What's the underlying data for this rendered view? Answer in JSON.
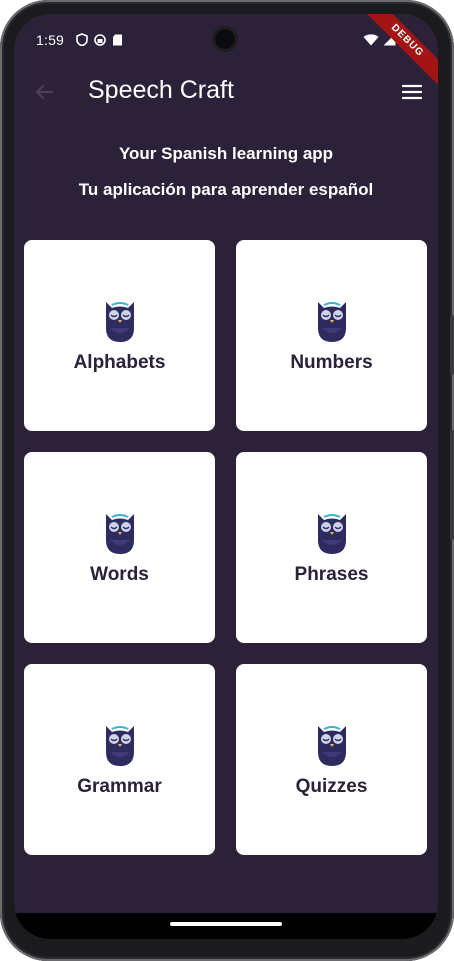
{
  "status": {
    "time": "1:59",
    "debug_label": "DEBUG"
  },
  "app_bar": {
    "title": "Speech Craft"
  },
  "intro": {
    "english": "Your Spanish learning app",
    "spanish": "Tu aplicación para aprender español"
  },
  "categories": [
    {
      "label": "Alphabets",
      "icon": "owl-icon"
    },
    {
      "label": "Numbers",
      "icon": "owl-icon"
    },
    {
      "label": "Words",
      "icon": "owl-icon"
    },
    {
      "label": "Phrases",
      "icon": "owl-icon"
    },
    {
      "label": "Grammar",
      "icon": "owl-icon"
    },
    {
      "label": "Quizzes",
      "icon": "owl-icon"
    }
  ],
  "colors": {
    "background": "#2b2139",
    "card": "#ffffff",
    "card_text": "#2b2139",
    "debug_ribbon": "#a31515"
  }
}
